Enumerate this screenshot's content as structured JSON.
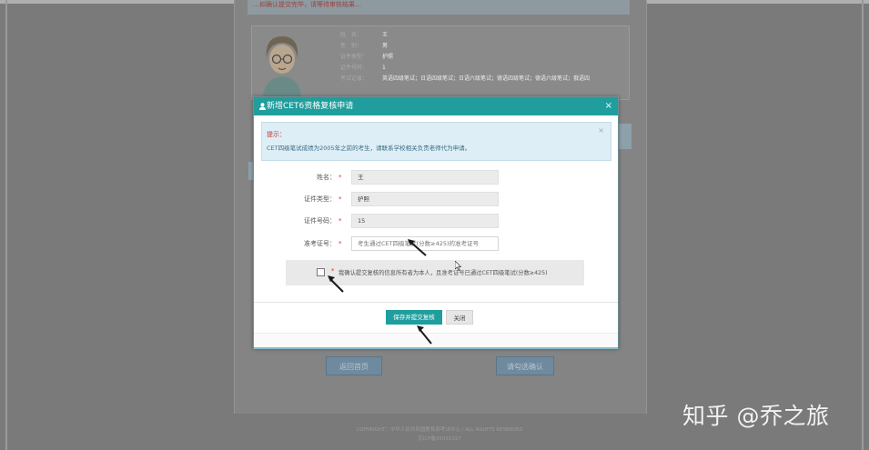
{
  "background": {
    "notice": "…如确认提交完毕，请等待审核结果…",
    "profile_fields": [
      {
        "label": "姓　名：",
        "value": "王"
      },
      {
        "label": "性　别：",
        "value": "男"
      },
      {
        "label": "证件类型：",
        "value": "护照"
      },
      {
        "label": "证件号码：",
        "value": "1"
      }
    ],
    "profile_history_label": "考试记录：",
    "profile_history": "英语四级笔试；日语四级笔试；日语六级笔试；德语四级笔试；德语六级笔试；俄语四",
    "buttons": {
      "back_home": "返回首页",
      "read_confirm": "请勾选确认"
    },
    "footer": {
      "copyright": "COPYRIGHT：中华人民共和国教育部考试中心 / ALL RIGHTS RESERVED",
      "icp": "京ICP备05031027"
    }
  },
  "watermark": "知乎 @乔之旅",
  "modal": {
    "title": "新增CET6资格复核申请",
    "close_symbol": "×",
    "tip": {
      "title": "提示：",
      "body": "CET四级笔试成绩为2005年之前的考生，请联系学校相关负责老师代为申请。",
      "close_symbol": "×"
    },
    "form": {
      "name": {
        "label": "姓名：",
        "required": "*",
        "value": "王"
      },
      "id_type": {
        "label": "证件类型：",
        "required": "*",
        "value": "护照"
      },
      "id_number": {
        "label": "证件号码：",
        "required": "*",
        "value": "15"
      },
      "ticket": {
        "label": "准考证号：",
        "required": "*",
        "placeholder": "考生通过CET四级笔试(分数≥425)的准考证号"
      }
    },
    "confirm": {
      "required": "*",
      "text": "我确认提交复核的信息所有者为本人，且准考证号已通过CET四级笔试(分数≥425)",
      "checked": false
    },
    "buttons": {
      "save_submit": "保存并提交复核",
      "close": "关闭"
    }
  },
  "colors": {
    "accent": "#1f9e9d",
    "overlay": "#7a7a7a",
    "tip_bg": "#ddeef6",
    "required": "#d33333"
  },
  "icons": [
    "user-icon",
    "close-icon",
    "arrow-pointer-icon",
    "mouse-cursor-icon",
    "avatar-illustration"
  ]
}
